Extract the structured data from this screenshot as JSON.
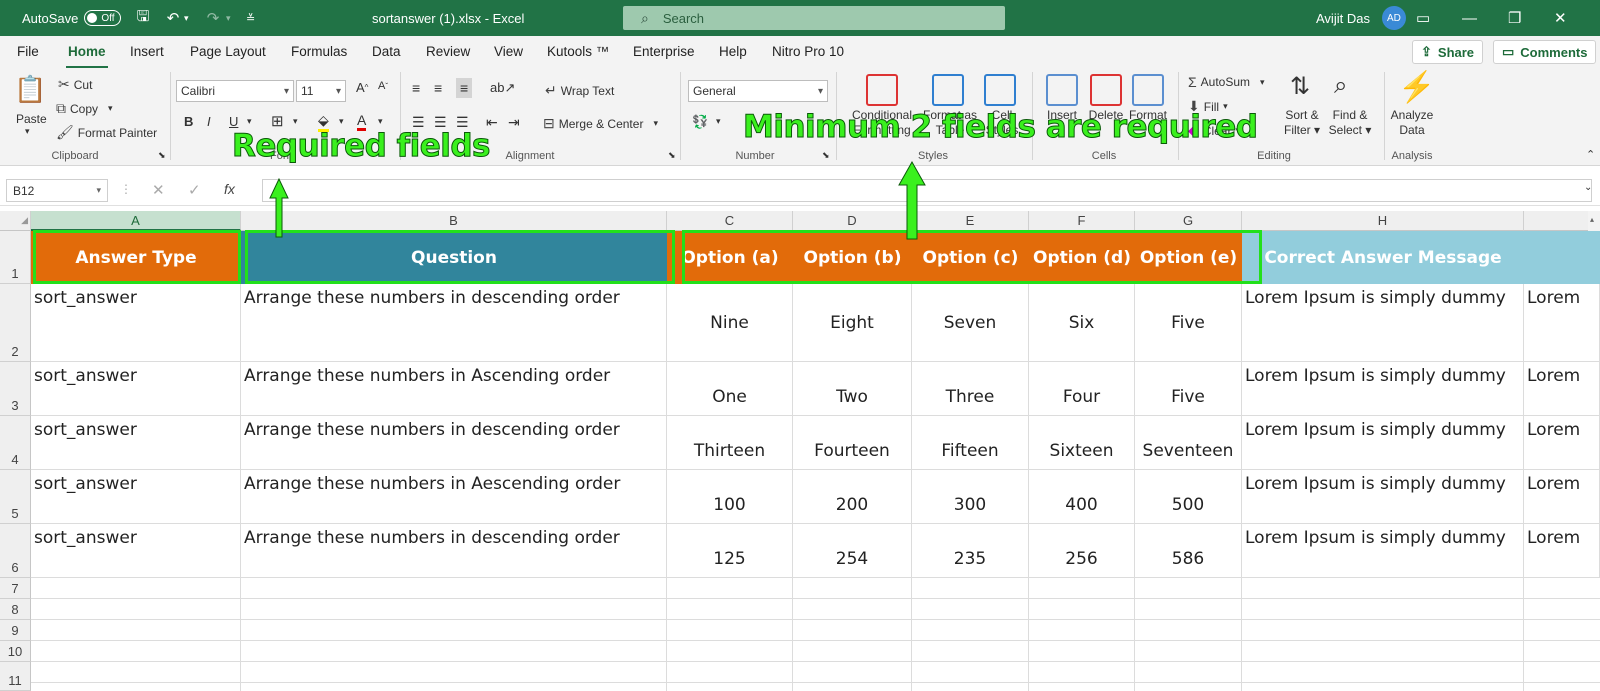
{
  "titlebar": {
    "autosave_label": "AutoSave",
    "autosave_state": "Off",
    "filename": "sortanswer (1).xlsx",
    "app_sep": " - ",
    "app": "Excel",
    "search_placeholder": "Search",
    "user": "Avijit Das",
    "initials": "AD",
    "bg_color": "#217346"
  },
  "menu": {
    "tabs": [
      "File",
      "Home",
      "Insert",
      "Page Layout",
      "Formulas",
      "Data",
      "Review",
      "View",
      "Kutools ™",
      "Enterprise",
      "Help",
      "Nitro Pro 10"
    ],
    "active_tab": "Home",
    "share": "Share",
    "comments": "Comments"
  },
  "ribbon": {
    "clipboard": {
      "paste": "Paste",
      "cut": "Cut",
      "copy": "Copy",
      "format_painter": "Format Painter",
      "label": "Clipboard"
    },
    "font": {
      "name": "Calibri",
      "size": "11",
      "bold": "B",
      "italic": "I",
      "underline": "U",
      "label": "Font"
    },
    "alignment": {
      "wrap": "Wrap Text",
      "merge": "Merge & Center",
      "label": "Alignment"
    },
    "number": {
      "format": "General",
      "label": "Number"
    },
    "styles": {
      "conditional": "Conditional Formatting",
      "format_as": "Format as Table",
      "cell_styles": "Cell Styles",
      "label": "Styles"
    },
    "cells": {
      "insert": "Insert",
      "delete": "Delete",
      "format": "Format",
      "label": "Cells"
    },
    "editing": {
      "autosum": "AutoSum",
      "fill": "Fill",
      "clear": "Clear",
      "sort": "Sort &",
      "filter": "Filter",
      "find": "Find &",
      "select": "Select",
      "label": "Editing"
    },
    "analysis": {
      "analyze": "Analyze",
      "data": "Data",
      "label": "Analysis"
    }
  },
  "formula_bar": {
    "name_box": "B12",
    "formula": "",
    "fx": "fx"
  },
  "grid": {
    "columns": [
      "A",
      "B",
      "C",
      "D",
      "E",
      "F",
      "G",
      "H"
    ],
    "rows": [
      "1",
      "2",
      "3",
      "4",
      "5",
      "6",
      "7",
      "8",
      "9",
      "10",
      "11"
    ],
    "headers": [
      "Answer Type",
      "Question",
      "Option (a)",
      "Option (b)",
      "Option (c)",
      "Option (d)",
      "Option (e)",
      "Correct Answer Message"
    ],
    "header_colors": {
      "orange": "#e26b0a",
      "teal": "#31859c",
      "lightblue": "#92cddc"
    },
    "data": [
      {
        "type": "sort_answer",
        "question": "Arrange these numbers in descending order",
        "a": "Nine",
        "b": "Eight",
        "c": "Seven",
        "d": "Six",
        "e": "Five",
        "msg": "Lorem Ipsum is simply dummy",
        "next": "Lorem"
      },
      {
        "type": "sort_answer",
        "question": "Arrange these numbers in Ascending order",
        "a": "One",
        "b": "Two",
        "c": "Three",
        "d": "Four",
        "e": "Five",
        "msg": "Lorem Ipsum is simply dummy",
        "next": "Lorem"
      },
      {
        "type": "sort_answer",
        "question": "Arrange these numbers in descending order",
        "a": "Thirteen",
        "b": "Fourteen",
        "c": "Fifteen",
        "d": "Sixteen",
        "e": "Seventeen",
        "msg": "Lorem Ipsum is simply dummy",
        "next": "Lorem"
      },
      {
        "type": "sort_answer",
        "question": "Arrange these numbers in Aescending order",
        "a": "100",
        "b": "200",
        "c": "300",
        "d": "400",
        "e": "500",
        "msg": "Lorem Ipsum is simply dummy",
        "next": "Lorem"
      },
      {
        "type": "sort_answer",
        "question": "Arrange these numbers in descending order",
        "a": "125",
        "b": "254",
        "c": "235",
        "d": "256",
        "e": "586",
        "msg": "Lorem Ipsum is simply dummy",
        "next": "Lorem"
      }
    ]
  },
  "annotations": {
    "required": "Required fields",
    "minimum": "Minimum 2 fields are required",
    "color": "#22e01a"
  }
}
